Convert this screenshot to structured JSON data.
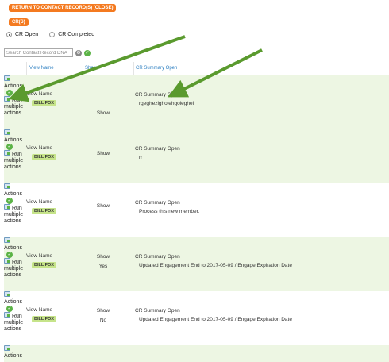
{
  "buttons": {
    "return_label": "RETURN TO CONTACT RECORD(S) (CLOSE)",
    "crs_label": "CR(S)"
  },
  "filter": {
    "options": [
      {
        "label": "CR Open",
        "checked": true
      },
      {
        "label": "CR Completed",
        "checked": false
      }
    ]
  },
  "search": {
    "placeholder": "Search Contact Record DNA"
  },
  "table": {
    "headers": {
      "view": "View Name",
      "share": "Share",
      "summary": "CR Summary Open"
    },
    "rows": [
      {
        "actions": "Actions",
        "run": "Run",
        "multiple": "multiple",
        "actions2": "actions",
        "view_name": "View Name",
        "badge": "BILL FOX",
        "share": "Show",
        "share2": "",
        "summary_title": "CR Summary Open",
        "summary_text": "rgeghezighoiehgoieghei"
      },
      {
        "actions": "Actions",
        "run": "Run",
        "multiple": "multiple",
        "actions2": "actions",
        "view_name": "View Name",
        "badge": "BILL FOX",
        "share": "Show",
        "share2": "",
        "summary_title": "CR Summary Open",
        "summary_text": "rr"
      },
      {
        "actions": "Actions",
        "run": "Run",
        "multiple": "multiple",
        "actions2": "actions",
        "view_name": "View Name",
        "badge": "BILL FOX",
        "share": "Show",
        "share2": "",
        "summary_title": "CR Summary Open",
        "summary_text": "Process this new member."
      },
      {
        "actions": "Actions",
        "run": "Run",
        "multiple": "multiple",
        "actions2": "actions",
        "view_name": "View Name",
        "badge": "BILL FOX",
        "share": "Show",
        "share2": "Yes",
        "summary_title": "CR Summary Open",
        "summary_text": "Updated Engagement End to 2017-05-09 / Engage Expiration Date"
      },
      {
        "actions": "Actions",
        "run": "Run",
        "multiple": "multiple",
        "actions2": "actions",
        "view_name": "View Name",
        "badge": "BILL FOX",
        "share": "Show",
        "share2": "No",
        "summary_title": "CR Summary Open",
        "summary_text": "Updated Engagement End to 2017-05-09 / Engage Expiration Date"
      }
    ],
    "last_row_actions": "Actions"
  },
  "colors": {
    "orange": "#f47a20",
    "green_row": "#edf6e3",
    "badge": "#c6e48a",
    "link_blue": "#2d7fc1",
    "arrow_green": "#5a9a2e"
  },
  "icons": [
    "gear-icon",
    "go-icon",
    "actions-icon",
    "check-icon",
    "run-icon"
  ]
}
